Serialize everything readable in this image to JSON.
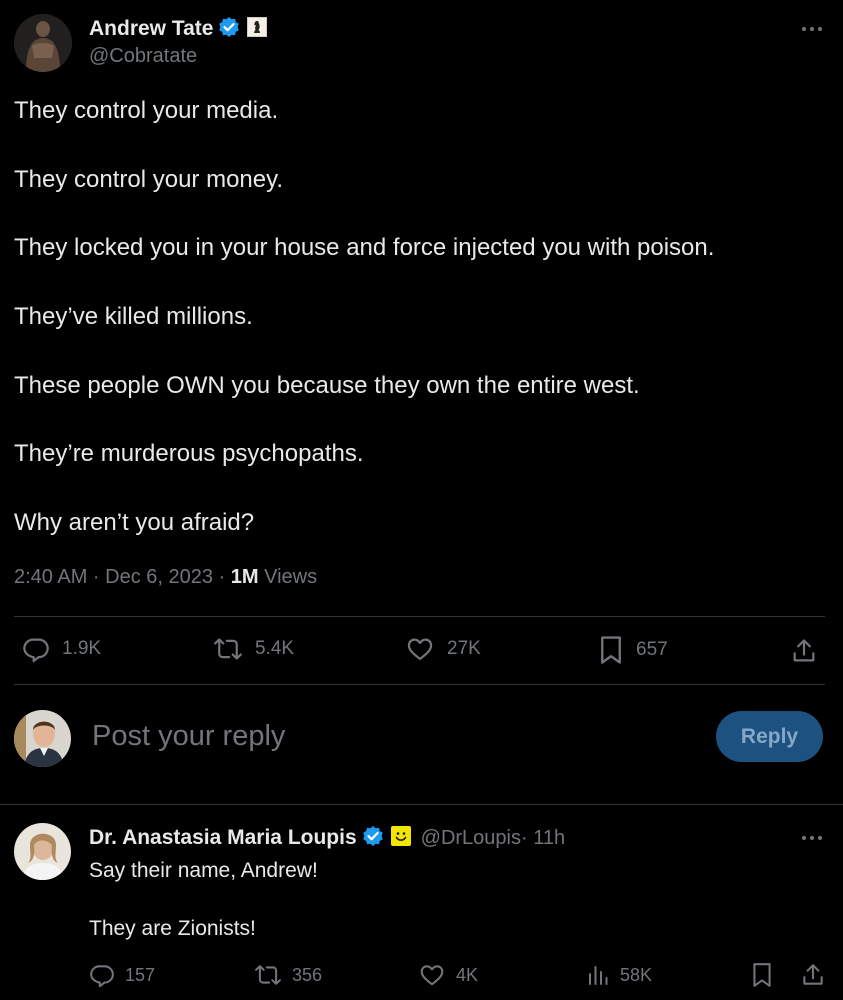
{
  "tweet": {
    "author_name": "Andrew Tate",
    "author_handle": "@Cobratate",
    "lines": [
      "They control your media.",
      "They control your money.",
      "They locked you in your house and force injected you with poison.",
      "They’ve killed millions.",
      "These people OWN you because they own the entire west.",
      "They’re murderous psychopaths.",
      "Why aren’t you afraid?"
    ],
    "meta_time": "2:40 AM · Dec 6, 2023 · ",
    "views_count": "1M",
    "views_label": " Views",
    "stats": {
      "replies": "1.9K",
      "reposts": "5.4K",
      "likes": "27K",
      "bookmarks": "657"
    }
  },
  "compose": {
    "placeholder": "Post your reply",
    "button_label": "Reply"
  },
  "reply": {
    "author_name": "Dr. Anastasia Maria Loupis",
    "author_handle": "@DrLoupis",
    "time": " · 11h",
    "lines": [
      "Say their name, Andrew!",
      "They are Zionists!"
    ],
    "stats": {
      "replies": "157",
      "reposts": "356",
      "likes": "4K",
      "views": "58K"
    }
  },
  "colors": {
    "background": "#000000",
    "text": "#e7e9ea",
    "muted": "#71767b",
    "verified": "#1d9bf0",
    "reply_button_bg": "#1d5280",
    "divider": "#2f3336"
  },
  "icons": [
    "more-icon",
    "verified-icon",
    "chess-badge-icon",
    "smiley-badge-icon",
    "reply-icon",
    "repost-icon",
    "like-icon",
    "bookmark-icon",
    "share-icon",
    "views-icon"
  ]
}
